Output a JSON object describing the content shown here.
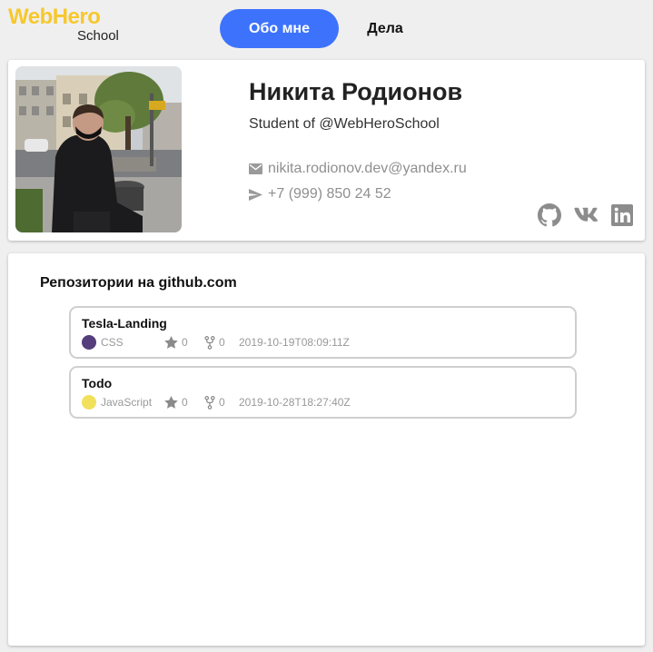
{
  "header": {
    "logo_top": "WebHero",
    "logo_bottom": "School",
    "tabs": [
      {
        "label": "Обо мне",
        "active": true
      },
      {
        "label": "Дела",
        "active": false
      }
    ]
  },
  "profile": {
    "name": "Никита Родионов",
    "role": "Student of @WebHeroSchool",
    "email": "nikita.rodionov.dev@yandex.ru",
    "phone": "+7 (999) 850 24 52",
    "socials": [
      "github-icon",
      "vk-icon",
      "linkedin-icon"
    ]
  },
  "repositories": {
    "title": "Репозитории на github.com",
    "items": [
      {
        "name": "Tesla-Landing",
        "language": "CSS",
        "language_color": "#563d7c",
        "stars": "0",
        "forks": "0",
        "updated": "2019-10-19T08:09:11Z"
      },
      {
        "name": "Todo",
        "language": "JavaScript",
        "language_color": "#f1e05a",
        "stars": "0",
        "forks": "0",
        "updated": "2019-10-28T18:27:40Z"
      }
    ]
  },
  "colors": {
    "accent": "#3d73fc",
    "logo": "#f6c82d",
    "background": "#f0eff0"
  }
}
